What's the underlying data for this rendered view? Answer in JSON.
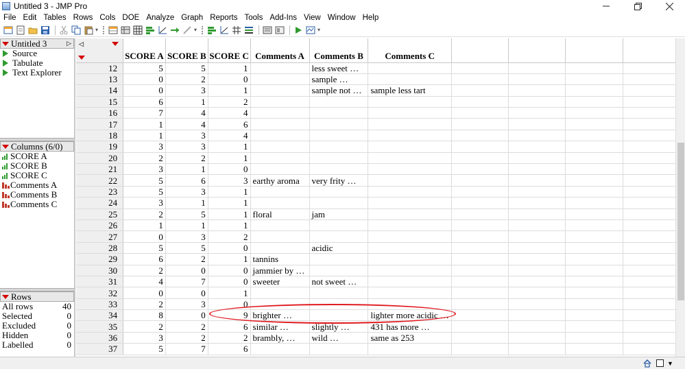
{
  "window": {
    "title": "Untitled 3 - JMP Pro"
  },
  "menu": [
    "File",
    "Edit",
    "Tables",
    "Rows",
    "Cols",
    "DOE",
    "Analyze",
    "Graph",
    "Reports",
    "Tools",
    "Add-Ins",
    "View",
    "Window",
    "Help"
  ],
  "table_panel": {
    "name": "Untitled 3",
    "scripts": [
      "Source",
      "Tabulate",
      "Text Explorer"
    ]
  },
  "columns_panel": {
    "title": "Columns (6/0)",
    "columns": [
      {
        "name": "SCORE A",
        "type": "continuous"
      },
      {
        "name": "SCORE B",
        "type": "continuous"
      },
      {
        "name": "SCORE C",
        "type": "continuous"
      },
      {
        "name": "Comments A",
        "type": "nominal"
      },
      {
        "name": "Comments B",
        "type": "nominal"
      },
      {
        "name": "Comments C",
        "type": "nominal"
      }
    ]
  },
  "rows_panel": {
    "title": "Rows",
    "stats": [
      {
        "label": "All rows",
        "value": "40"
      },
      {
        "label": "Selected",
        "value": "0"
      },
      {
        "label": "Excluded",
        "value": "0"
      },
      {
        "label": "Hidden",
        "value": "0"
      },
      {
        "label": "Labelled",
        "value": "0"
      }
    ]
  },
  "grid": {
    "headers": [
      "SCORE A",
      "SCORE B",
      "SCORE C",
      "Comments A",
      "Comments B",
      "Comments C"
    ],
    "rows": [
      {
        "n": "12",
        "a": "5",
        "b": "5",
        "c": "1",
        "ca": "",
        "cb": "less sweet …",
        "cc": ""
      },
      {
        "n": "13",
        "a": "0",
        "b": "2",
        "c": "0",
        "ca": "",
        "cb": "sample …",
        "cc": ""
      },
      {
        "n": "14",
        "a": "0",
        "b": "3",
        "c": "1",
        "ca": "",
        "cb": "sample not …",
        "cc": "sample less tart"
      },
      {
        "n": "15",
        "a": "6",
        "b": "1",
        "c": "2",
        "ca": "",
        "cb": "",
        "cc": ""
      },
      {
        "n": "16",
        "a": "7",
        "b": "4",
        "c": "4",
        "ca": "",
        "cb": "",
        "cc": ""
      },
      {
        "n": "17",
        "a": "1",
        "b": "4",
        "c": "6",
        "ca": "",
        "cb": "",
        "cc": ""
      },
      {
        "n": "18",
        "a": "1",
        "b": "3",
        "c": "4",
        "ca": "",
        "cb": "",
        "cc": ""
      },
      {
        "n": "19",
        "a": "3",
        "b": "3",
        "c": "1",
        "ca": "",
        "cb": "",
        "cc": ""
      },
      {
        "n": "20",
        "a": "2",
        "b": "2",
        "c": "1",
        "ca": "",
        "cb": "",
        "cc": ""
      },
      {
        "n": "21",
        "a": "3",
        "b": "1",
        "c": "0",
        "ca": "",
        "cb": "",
        "cc": ""
      },
      {
        "n": "22",
        "a": "5",
        "b": "6",
        "c": "3",
        "ca": "earthy aroma",
        "cb": "very frity …",
        "cc": ""
      },
      {
        "n": "23",
        "a": "5",
        "b": "3",
        "c": "1",
        "ca": "",
        "cb": "",
        "cc": ""
      },
      {
        "n": "24",
        "a": "3",
        "b": "1",
        "c": "1",
        "ca": "",
        "cb": "",
        "cc": ""
      },
      {
        "n": "25",
        "a": "2",
        "b": "5",
        "c": "1",
        "ca": "floral",
        "cb": "jam",
        "cc": ""
      },
      {
        "n": "26",
        "a": "1",
        "b": "1",
        "c": "1",
        "ca": "",
        "cb": "",
        "cc": ""
      },
      {
        "n": "27",
        "a": "0",
        "b": "3",
        "c": "2",
        "ca": "",
        "cb": "",
        "cc": ""
      },
      {
        "n": "28",
        "a": "5",
        "b": "5",
        "c": "0",
        "ca": "",
        "cb": "acidic",
        "cc": ""
      },
      {
        "n": "29",
        "a": "6",
        "b": "2",
        "c": "1",
        "ca": "tannins",
        "cb": "",
        "cc": ""
      },
      {
        "n": "30",
        "a": "2",
        "b": "0",
        "c": "0",
        "ca": "jammier by …",
        "cb": "",
        "cc": ""
      },
      {
        "n": "31",
        "a": "4",
        "b": "7",
        "c": "0",
        "ca": "sweeter",
        "cb": "not sweet …",
        "cc": ""
      },
      {
        "n": "32",
        "a": "0",
        "b": "0",
        "c": "1",
        "ca": "",
        "cb": "",
        "cc": ""
      },
      {
        "n": "33",
        "a": "2",
        "b": "3",
        "c": "0",
        "ca": "",
        "cb": "",
        "cc": ""
      },
      {
        "n": "34",
        "a": "8",
        "b": "0",
        "c": "9",
        "ca": "brighter …",
        "cb": "",
        "cc": "lighter more acidic …"
      },
      {
        "n": "35",
        "a": "2",
        "b": "2",
        "c": "6",
        "ca": "similar …",
        "cb": "slightly …",
        "cc": "431 has more …"
      },
      {
        "n": "36",
        "a": "3",
        "b": "2",
        "c": "2",
        "ca": "brambly, …",
        "cb": "wild …",
        "cc": "same as 253"
      },
      {
        "n": "37",
        "a": "5",
        "b": "7",
        "c": "6",
        "ca": "",
        "cb": "",
        "cc": ""
      }
    ]
  },
  "colors": {
    "annotation": "#e0191e",
    "disclosure": "#d40000",
    "continuous": "#2e9a2e",
    "nominal": "#c0392b"
  }
}
